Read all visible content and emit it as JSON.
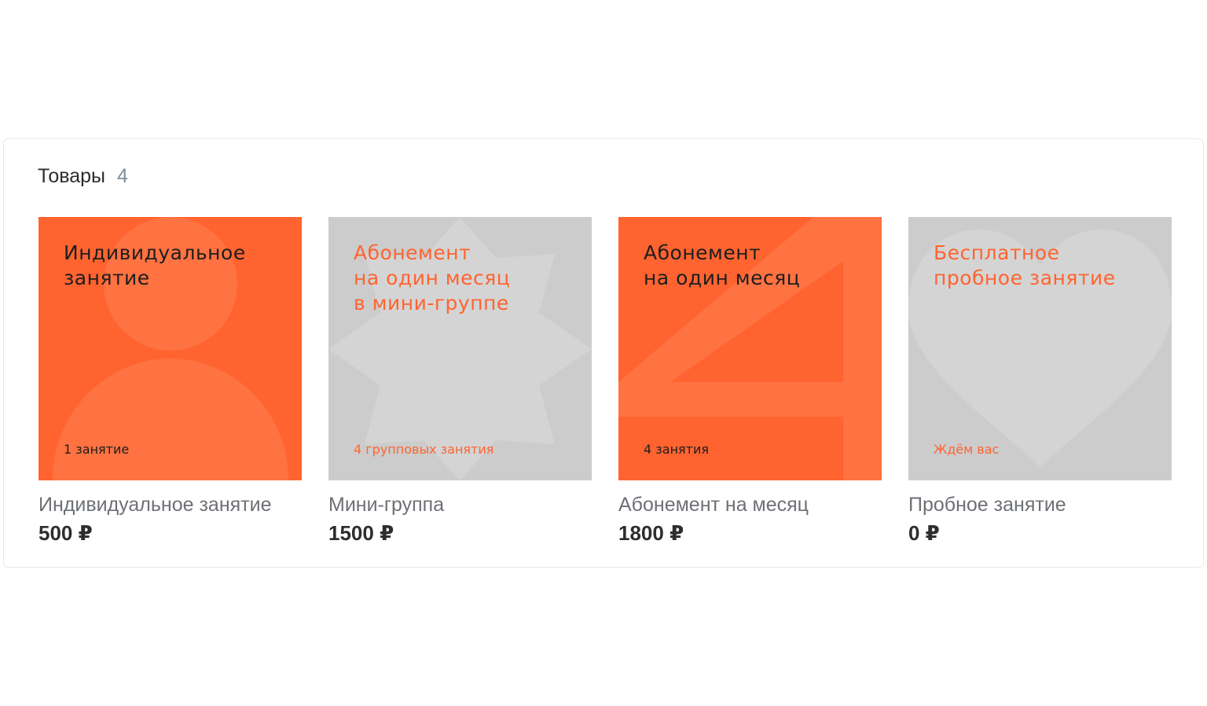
{
  "section": {
    "title": "Товары",
    "count": "4"
  },
  "products": [
    {
      "cover_title": "Индивидуальное\nзанятие",
      "cover_caption": "1 занятие",
      "cover_style": "orange",
      "cover_icon": "person-icon",
      "name": "Индивидуальное занятие",
      "price": "500 ₽"
    },
    {
      "cover_title": "Абонемент\nна один месяц\nв мини-группе",
      "cover_caption": "4 групповых занятия",
      "cover_style": "gray",
      "cover_icon": "star-icon",
      "name": "Мини-группа",
      "price": "1500 ₽"
    },
    {
      "cover_title": "Абонемент\nна один месяц",
      "cover_caption": "4 занятия",
      "cover_style": "orange",
      "cover_icon": "number-four-icon",
      "name": "Абонемент на месяц",
      "price": "1800 ₽"
    },
    {
      "cover_title": "Бесплатное\nпробное занятие",
      "cover_caption": "Ждём вас",
      "cover_style": "gray",
      "cover_icon": "heart-icon",
      "name": "Пробное занятие",
      "price": "0 ₽"
    }
  ],
  "colors": {
    "accent": "#ff6430",
    "cover_gray": "#cccccc",
    "title_text": "#2c2d2e",
    "muted_text": "#818c99"
  }
}
